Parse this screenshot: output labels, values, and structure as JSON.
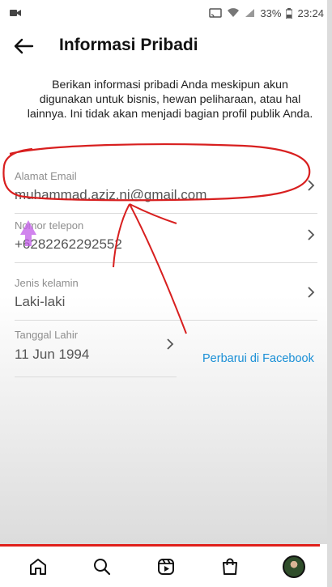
{
  "status_bar": {
    "battery": "33%",
    "time": "23:24"
  },
  "header": {
    "title": "Informasi Pribadi"
  },
  "description": "Berikan informasi pribadi Anda meskipun akun digunakan untuk bisnis, hewan peliharaan, atau hal lainnya. Ini tidak akan menjadi bagian profil publik Anda.",
  "fields": [
    {
      "label": "Alamat Email",
      "value": "muhammad.aziz.ni@gmail.com"
    },
    {
      "label": "Nomor telepon",
      "value": "+6282262292552"
    },
    {
      "label": "Jenis kelamin",
      "value": "Laki-laki"
    },
    {
      "label": "Tanggal Lahir",
      "value": "11 Jun 1994"
    }
  ],
  "facebook_link": "Perbarui di Facebook",
  "colors": {
    "link": "#1a8fd6",
    "annotation_red": "#d81f1f",
    "arrow_purple": "#c25be8"
  },
  "icons": {
    "back": "arrow-left-icon",
    "chevron": "chevron-right-icon",
    "nav": [
      "home-icon",
      "search-icon",
      "reels-icon",
      "shop-icon",
      "profile-avatar"
    ]
  }
}
